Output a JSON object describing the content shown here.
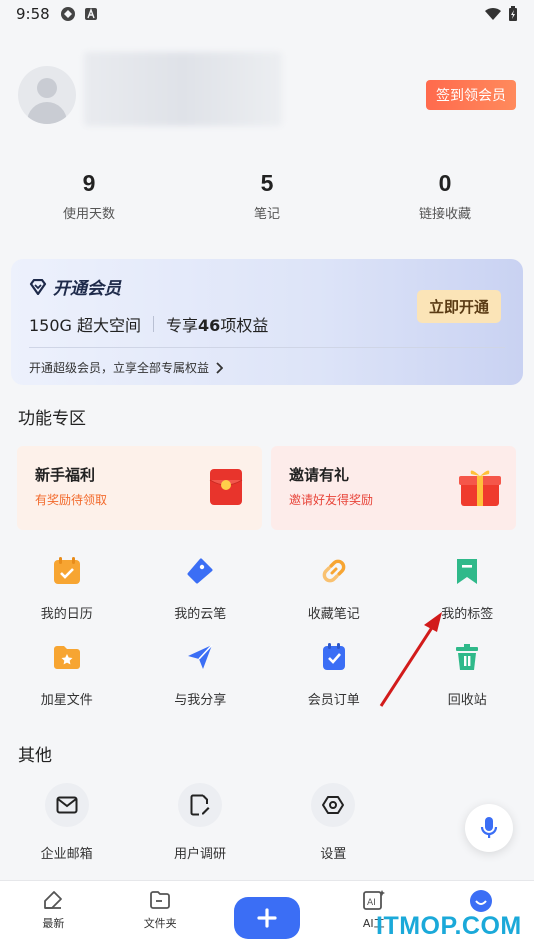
{
  "status_bar": {
    "time": "9:58"
  },
  "profile": {
    "signin_label": "签到领会员"
  },
  "stats": [
    {
      "value": "9",
      "label": "使用天数"
    },
    {
      "value": "5",
      "label": "笔记"
    },
    {
      "value": "0",
      "label": "链接收藏"
    }
  ],
  "vip": {
    "title": "开通会员",
    "space": "150G 超大空间",
    "benefits_prefix": "专享",
    "benefits_count": "46",
    "benefits_suffix": "项权益",
    "button": "立即开通",
    "footer": "开通超级会员，立享全部专属权益"
  },
  "features": {
    "title": "功能专区",
    "promos": [
      {
        "title": "新手福利",
        "subtitle": "有奖励待领取"
      },
      {
        "title": "邀请有礼",
        "subtitle": "邀请好友得奖励"
      }
    ],
    "row1": [
      {
        "label": "我的日历",
        "icon": "calendar-icon",
        "color": "#f7a532"
      },
      {
        "label": "我的云笔",
        "icon": "pen-tag-icon",
        "color": "#3b6ef5"
      },
      {
        "label": "收藏笔记",
        "icon": "link-icon",
        "color": "#f7a532"
      },
      {
        "label": "我的标签",
        "icon": "bookmark-icon",
        "color": "#2fb98a"
      }
    ],
    "row2": [
      {
        "label": "加星文件",
        "icon": "star-folder-icon",
        "color": "#f7a532"
      },
      {
        "label": "与我分享",
        "icon": "send-icon",
        "color": "#3b6ef5"
      },
      {
        "label": "会员订单",
        "icon": "order-icon",
        "color": "#3b6ef5"
      },
      {
        "label": "回收站",
        "icon": "trash-icon",
        "color": "#2fb98a"
      }
    ]
  },
  "other": {
    "title": "其他",
    "items": [
      {
        "label": "企业邮箱",
        "icon": "mail-icon"
      },
      {
        "label": "用户调研",
        "icon": "survey-icon"
      },
      {
        "label": "设置",
        "icon": "settings-icon"
      }
    ]
  },
  "bottom_nav": {
    "tabs": [
      {
        "label": "最新",
        "icon": "recent-icon"
      },
      {
        "label": "文件夹",
        "icon": "folder-icon"
      },
      {
        "label": "",
        "icon": "plus-icon"
      },
      {
        "label": "AI工",
        "icon": "ai-icon"
      },
      {
        "label": "",
        "icon": "me-icon"
      }
    ]
  },
  "watermark": "ITMOP.COM",
  "colors": {
    "accent": "#3b6ef5",
    "signin": "#ff6a4d",
    "vip_button": "#fbe4b7",
    "arrow": "#d21b1b"
  }
}
